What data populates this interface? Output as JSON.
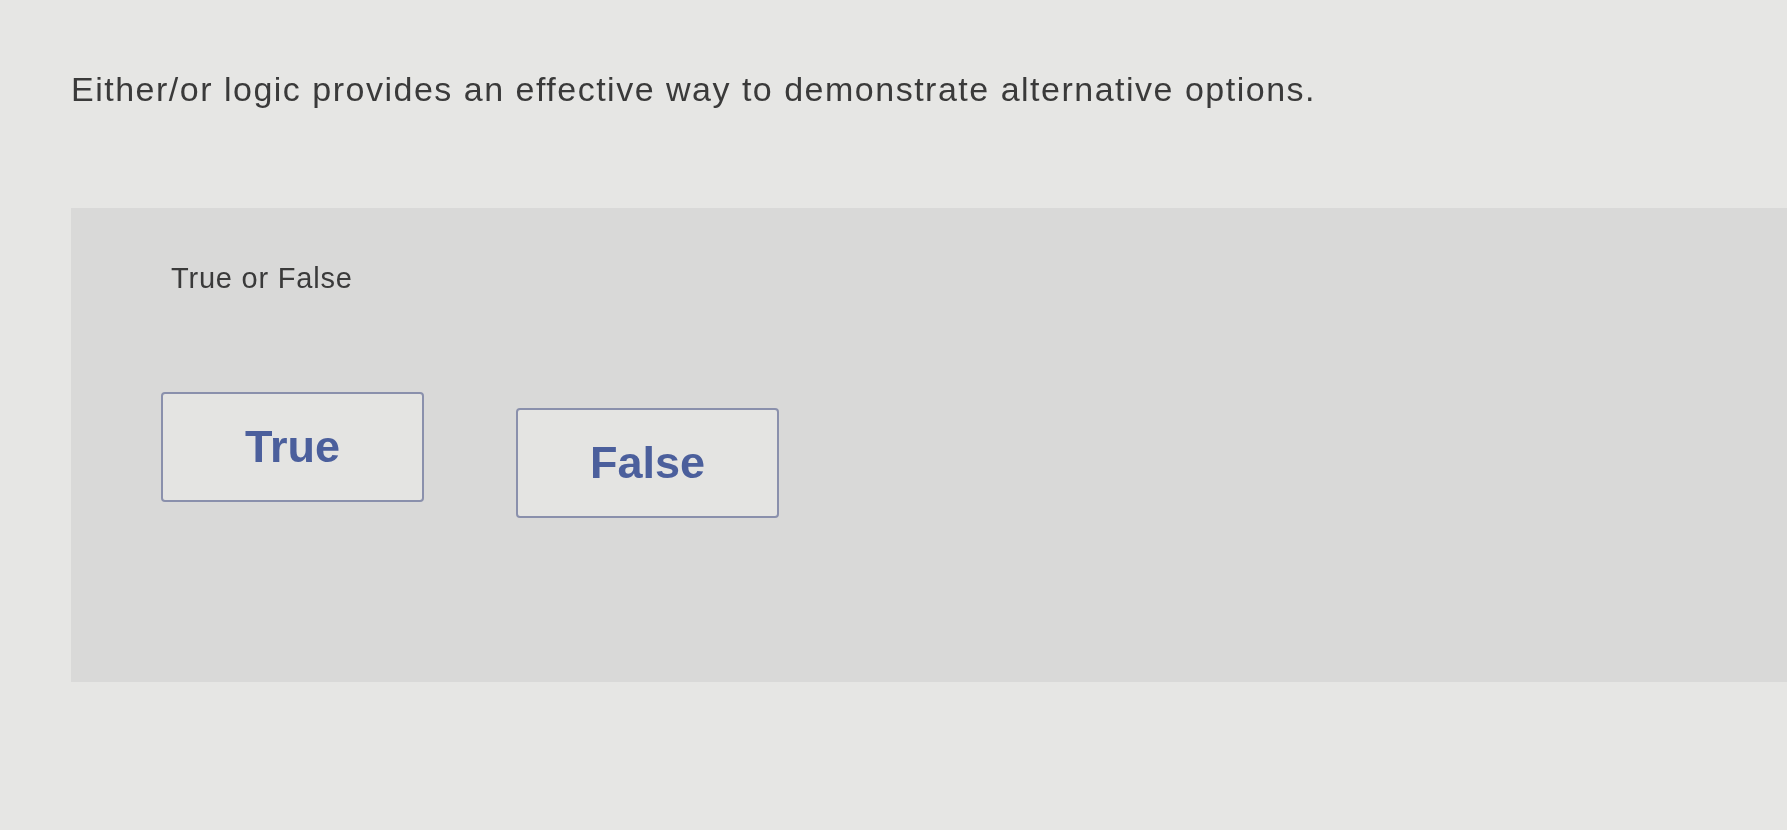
{
  "question": {
    "text": "Either/or logic provides an effective way to demonstrate alternative options."
  },
  "answer_panel": {
    "prompt": "True or False",
    "options": [
      {
        "label": "True",
        "selected": false
      },
      {
        "label": "False",
        "selected": false
      }
    ]
  }
}
